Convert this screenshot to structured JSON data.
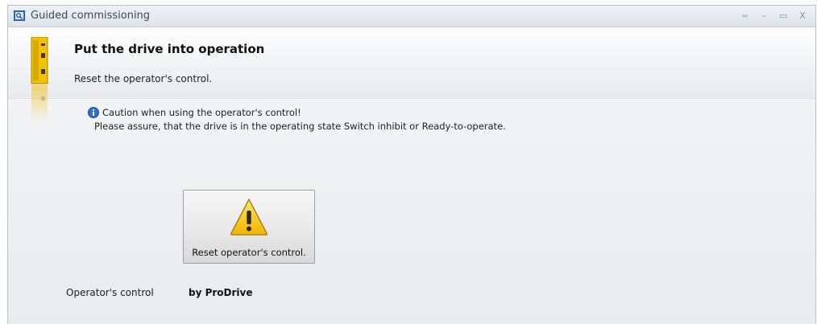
{
  "window": {
    "title": "Guided commissioning",
    "controls": {
      "pin": "⑅",
      "minimize": "–",
      "maximize": "▭",
      "close": "X"
    }
  },
  "header": {
    "title": "Put the drive into operation",
    "subtitle": "Reset the operator's control."
  },
  "info": {
    "line1": "Caution when using the operator's control!",
    "line2": "Please assure, that the drive is in the operating state Switch inhibit or Ready-to-operate."
  },
  "reset_button": {
    "label": "Reset operator's control."
  },
  "operator_control": {
    "label": "Operator's control",
    "value": "by ProDrive"
  },
  "colors": {
    "accent_yellow": "#f2c200",
    "info_blue": "#2f6fd0",
    "title_text": "#3b4a5c"
  }
}
